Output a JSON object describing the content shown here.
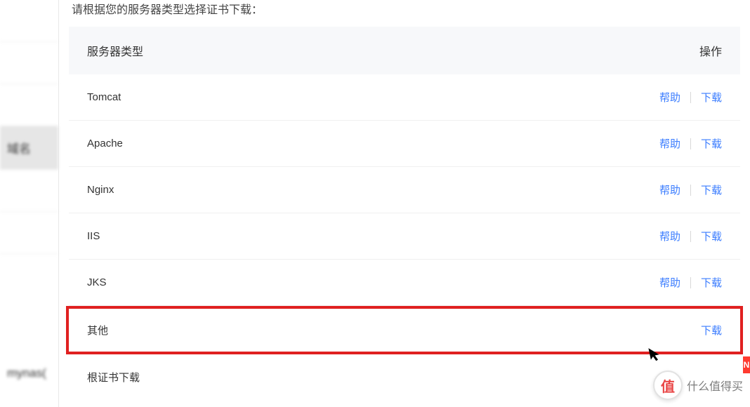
{
  "sidebar": {
    "item_domain": "域名",
    "item_bottom": "mynas("
  },
  "intro": "请根据您的服务器类型选择证书下载：",
  "table": {
    "header": {
      "server_type": "服务器类型",
      "action": "操作"
    },
    "rows": [
      {
        "name": "Tomcat",
        "help": "帮助",
        "download": "下载",
        "has_help": true
      },
      {
        "name": "Apache",
        "help": "帮助",
        "download": "下载",
        "has_help": true
      },
      {
        "name": "Nginx",
        "help": "帮助",
        "download": "下载",
        "has_help": true
      },
      {
        "name": "IIS",
        "help": "帮助",
        "download": "下载",
        "has_help": true
      },
      {
        "name": "JKS",
        "help": "帮助",
        "download": "下载",
        "has_help": true
      },
      {
        "name": "其他",
        "download": "下载",
        "has_help": false,
        "highlighted": true
      },
      {
        "name": "根证书下载",
        "has_help": false
      }
    ]
  },
  "watermark": {
    "logo": "值",
    "text": "什么值得买"
  },
  "badge": "N"
}
